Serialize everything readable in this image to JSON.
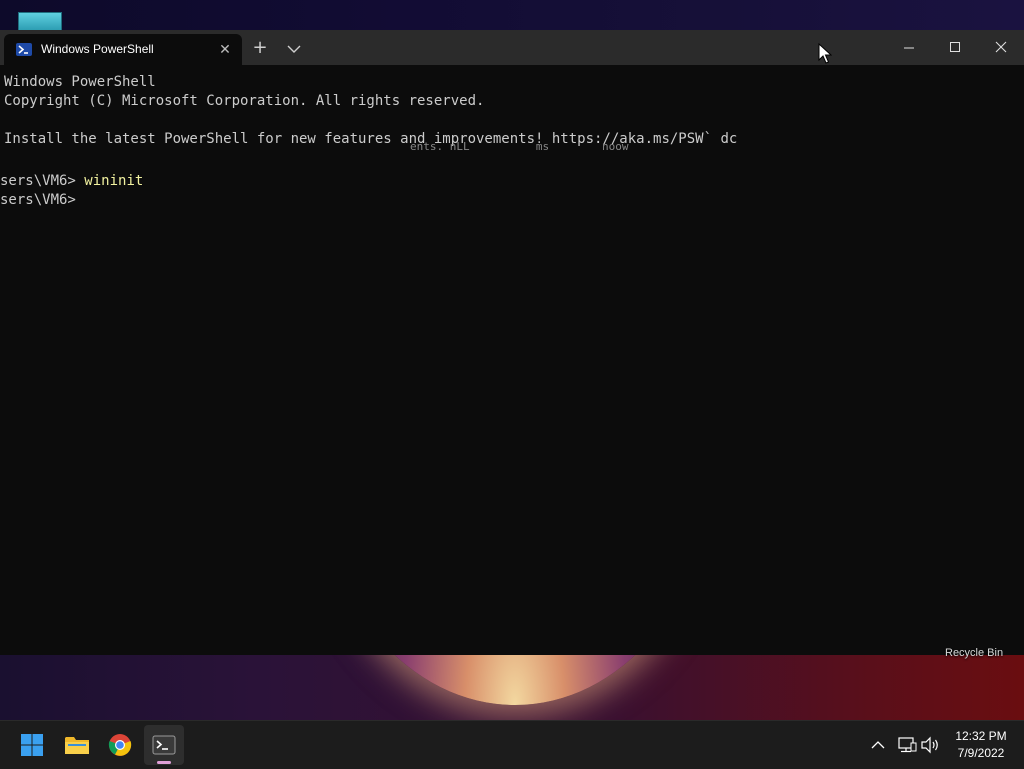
{
  "desktop": {
    "recycle_bin_label": "Recycle Bin"
  },
  "window": {
    "tab_title": "Windows PowerShell",
    "tab_icon": "powershell-icon",
    "new_tab_symbol": "+",
    "close_tab_symbol": "✕"
  },
  "console": {
    "lines": [
      "Windows PowerShell",
      "Copyright (C) Microsoft Corporation. All rights reserved.",
      "",
      "Install the latest PowerShell for new features and improvements! https://aka.ms/PSW` dc",
      "",
      "sers\\VM6> ",
      "sers\\VM6> "
    ],
    "command": "wininit",
    "ghost_text": "ents. nLL          ms        noow"
  },
  "taskbar": {
    "apps": [
      "start-icon",
      "file-explorer-icon",
      "chrome-icon",
      "terminal-icon"
    ],
    "time": "12:32 PM",
    "date": "7/9/2022"
  },
  "colors": {
    "console_bg": "#0c0c0c",
    "console_text": "#cccccc",
    "command_text": "#f2f2a0",
    "titlebar_bg": "#2b2b2b",
    "taskbar_bg": "#1c1c1c",
    "accent": "#e0a0d8"
  }
}
